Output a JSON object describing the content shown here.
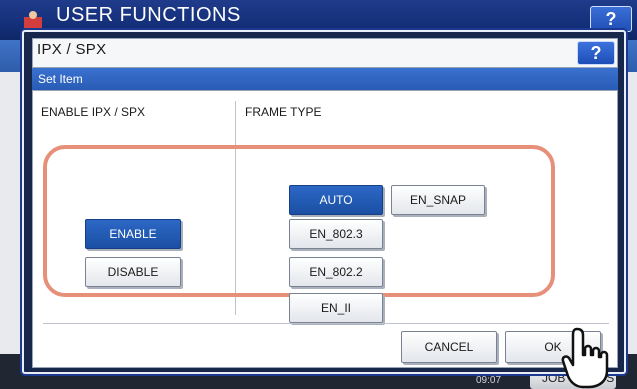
{
  "background": {
    "title": "USER FUNCTIONS",
    "help_label": "?",
    "time": "09:07",
    "job_label": "JOB STATUS",
    "icon_name": "user-functions-icon"
  },
  "dialog": {
    "title": "IPX / SPX",
    "help_label": "?",
    "set_item_label": "Set Item",
    "enable_header": "ENABLE IPX / SPX",
    "frame_header": "FRAME TYPE",
    "enable_options": [
      {
        "label": "ENABLE",
        "selected": true
      },
      {
        "label": "DISABLE",
        "selected": false
      }
    ],
    "frame_options": [
      {
        "label": "AUTO",
        "selected": true
      },
      {
        "label": "EN_SNAP",
        "selected": false
      },
      {
        "label": "EN_802.3",
        "selected": false
      },
      {
        "label": "EN_802.2",
        "selected": false
      },
      {
        "label": "EN_II",
        "selected": false
      }
    ],
    "cancel_label": "CANCEL",
    "ok_label": "OK"
  },
  "colors": {
    "selected_button": "#1a4fa3",
    "focus_ring": "#e6907a",
    "title_bar": "#14307a"
  }
}
